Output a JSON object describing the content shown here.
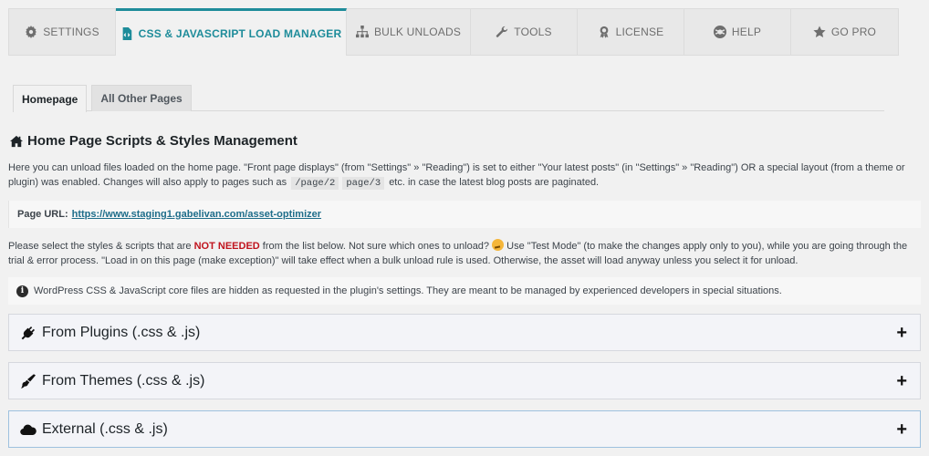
{
  "topnav": {
    "tabs": [
      {
        "label": "Settings",
        "icon": "gear-icon",
        "active": false
      },
      {
        "label": "CSS & JavaScript Load Manager",
        "icon": "file-code-icon",
        "active": true
      },
      {
        "label": "Bulk Unloads",
        "icon": "sitemap-icon",
        "active": false
      },
      {
        "label": "Tools",
        "icon": "wrench-icon",
        "active": false
      },
      {
        "label": "License",
        "icon": "award-icon",
        "active": false
      },
      {
        "label": "Help",
        "icon": "life-ring-icon",
        "active": false
      },
      {
        "label": "Go Pro",
        "icon": "star-icon",
        "active": false
      }
    ],
    "accent_color": "#1e8c9a"
  },
  "subtabs": [
    {
      "label": "Homepage",
      "active": true
    },
    {
      "label": "All Other Pages",
      "active": false
    }
  ],
  "section": {
    "title": "Home Page Scripts & Styles Management",
    "icon": "home-icon",
    "intro_part1": "Here you can unload files loaded on the home page. \"Front page displays\" (from \"Settings\" » \"Reading\") is set to either \"Your latest posts\" (in \"Settings\" » \"Reading\") OR a special layout (from a theme or plugin) was enabled. Changes will also apply to pages such as",
    "code1": "/page/2",
    "code2": "page/3",
    "intro_part2": "etc. in case the latest blog posts are paginated."
  },
  "page_url": {
    "label": "Page URL:",
    "url": "https://www.staging1.gabelivan.com/asset-optimizer"
  },
  "instructions": {
    "part1": "Please select the styles & scripts that are",
    "highlight": "NOT NEEDED",
    "part2": "from the list below. Not sure which ones to unload?",
    "emoji": "thinking-face-emoji",
    "part3": "Use \"Test Mode\" (to make the changes apply only to you), while you are going through the trial & error process. \"Load in on this page (make exception)\" will take effect when a bulk unload rule is used. Otherwise, the asset will load anyway unless you select it for unload.",
    "highlight_color": "#c0141e"
  },
  "notice": {
    "icon": "info-icon",
    "text": "WordPress CSS & JavaScript core files are hidden as requested in the plugin's settings. They are meant to be managed by experienced developers in special situations."
  },
  "accordions": [
    {
      "label": "From Plugins (.css & .js)",
      "icon": "plug-icon",
      "toggle": "+"
    },
    {
      "label": "From Themes (.css & .js)",
      "icon": "paint-brush-icon",
      "toggle": "+"
    },
    {
      "label": "External (.css & .js)",
      "icon": "cloud-icon",
      "toggle": "+"
    }
  ]
}
